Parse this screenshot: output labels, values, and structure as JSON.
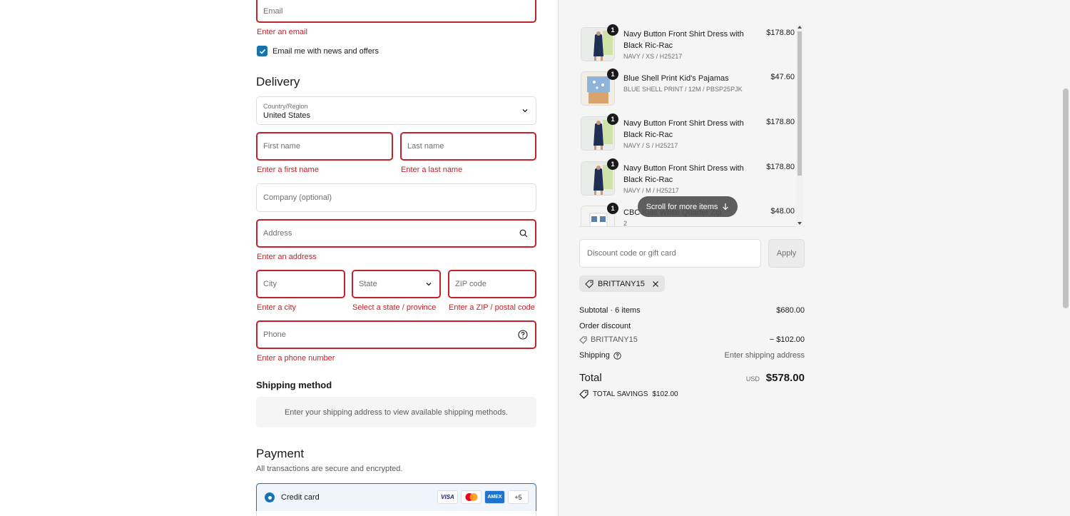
{
  "contact": {
    "email_placeholder": "Email",
    "email_error": "Enter an email",
    "newsletter_label": "Email me with news and offers",
    "newsletter_checked": true
  },
  "delivery": {
    "heading": "Delivery",
    "country_label": "Country/Region",
    "country_value": "United States",
    "first_name_placeholder": "First name",
    "first_name_error": "Enter a first name",
    "last_name_placeholder": "Last name",
    "last_name_error": "Enter a last name",
    "company_placeholder": "Company (optional)",
    "address_placeholder": "Address",
    "address_error": "Enter an address",
    "city_placeholder": "City",
    "city_error": "Enter a city",
    "state_placeholder": "State",
    "state_error": "Select a state / province",
    "zip_placeholder": "ZIP code",
    "zip_error": "Enter a ZIP / postal code",
    "phone_placeholder": "Phone",
    "phone_error": "Enter a phone number"
  },
  "shipping_method": {
    "heading": "Shipping method",
    "message": "Enter your shipping address to view available shipping methods."
  },
  "payment": {
    "heading": "Payment",
    "subtitle": "All transactions are secure and encrypted.",
    "option_label": "Credit card",
    "cards": [
      "VISA",
      "mastercard",
      "AMEX"
    ],
    "more_cards": "+5"
  },
  "cart": {
    "items": [
      {
        "qty": "1",
        "name": "Navy Button Front Shirt Dress with Black Ric-Rac",
        "variant": "NAVY / XS / H25217",
        "price": "$178.80"
      },
      {
        "qty": "1",
        "name": "Blue Shell Print Kid's Pajamas",
        "variant": "BLUE SHELL PRINT / 12M / PBSP25PJK",
        "price": "$47.60"
      },
      {
        "qty": "1",
        "name": "Navy Button Front Shirt Dress with Black Ric-Rac",
        "variant": "NAVY / S / H25217",
        "price": "$178.80"
      },
      {
        "qty": "1",
        "name": "Navy Button Front Shirt Dress with Black Ric-Rac",
        "variant": "NAVY / M / H25217",
        "price": "$178.80"
      },
      {
        "qty": "1",
        "name": "CBC Kids White Quarter Zip",
        "variant": "2",
        "price": "$48.00"
      }
    ],
    "scroll_hint": "Scroll for more items"
  },
  "discount": {
    "placeholder": "Discount code or gift card",
    "apply_label": "Apply",
    "applied_code": "BRITTANY15"
  },
  "summary": {
    "subtotal_label": "Subtotal · 6 items",
    "subtotal_value": "$680.00",
    "order_discount_label": "Order discount",
    "discount_code": "BRITTANY15",
    "discount_value": "− $102.00",
    "shipping_label": "Shipping",
    "shipping_value": "Enter shipping address",
    "total_label": "Total",
    "currency": "USD",
    "total_value": "$578.00",
    "savings_label": "TOTAL SAVINGS",
    "savings_value": "$102.00"
  },
  "colors": {
    "error": "#c3222b",
    "accent": "#1773b0"
  }
}
